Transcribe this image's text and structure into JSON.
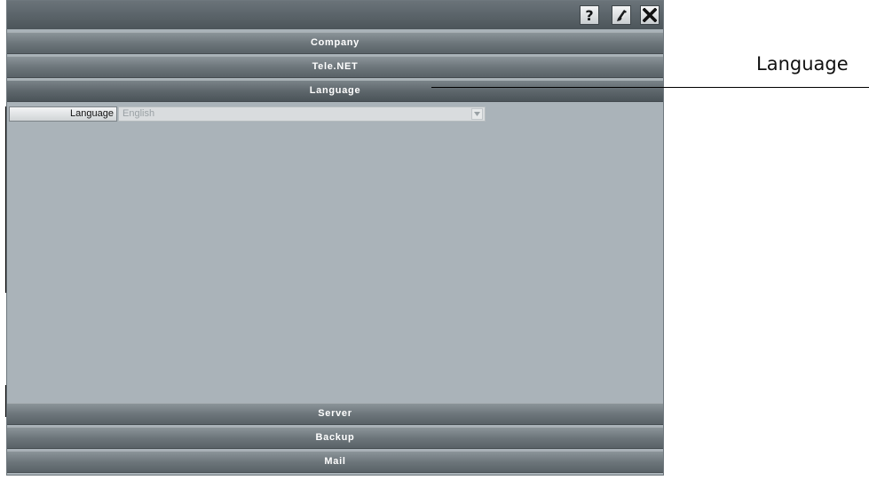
{
  "toolbar": {
    "help_icon": "help-question-icon",
    "edit_icon": "edit-pencil-icon",
    "close_icon": "close-x-icon",
    "help_glyph": "?"
  },
  "sections": {
    "company": "Company",
    "telenet": "Tele.NET",
    "language": "Language",
    "server": "Server",
    "backup": "Backup",
    "mail": "Mail"
  },
  "language_form": {
    "label": "Language",
    "value": "English"
  },
  "callout": {
    "text": "Language"
  }
}
